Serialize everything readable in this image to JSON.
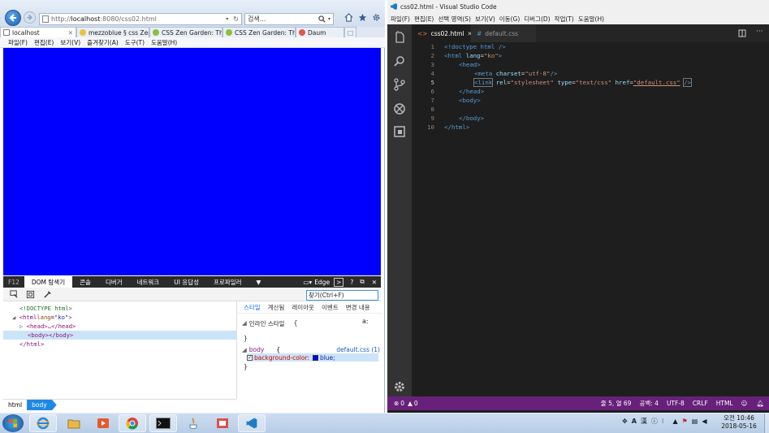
{
  "ie": {
    "address_host": "localhost",
    "address_pre": "http://",
    "address_post": ":8080/css02.html",
    "search_placeholder": "검색...",
    "tabs": [
      {
        "label": "localhost"
      },
      {
        "label": "mezzoblue § css Zen..."
      },
      {
        "label": "CSS Zen Garden: The..."
      },
      {
        "label": "CSS Zen Garden: The..."
      },
      {
        "label": "Daum"
      }
    ],
    "menu": [
      "파일(F)",
      "편집(E)",
      "보기(V)",
      "즐겨찾기(A)",
      "도구(T)",
      "도움말(H)"
    ],
    "page_background": "#0000ff"
  },
  "devtools": {
    "f12_label": "F12",
    "tabs": [
      "DOM 탐색기",
      "콘솔",
      "디버거",
      "네트워크",
      "UI 응답성",
      "프로파일러"
    ],
    "mode_label": "Edge",
    "find_placeholder": "찾기(Ctrl+F)",
    "dom": {
      "doctype": "<!DOCTYPE html>",
      "html_open": "<html",
      "lang_attr": "lang",
      "lang_val": "\"ko\"",
      "head": "<head>…</head>",
      "body": "<body></body>",
      "html_close": "</html>"
    },
    "style_tabs": [
      "스타일",
      "계산됨",
      "레이아웃",
      "이벤트",
      "변경 내용"
    ],
    "inline_label": "인라인 스타일",
    "inline_brace_open": "{",
    "inline_brace_close": "}",
    "aa_label": "a:",
    "rule_selector": "body",
    "rule_brace_open": "{",
    "rule_source": "default.css (1)",
    "rule_prop": "background-color:",
    "rule_value": "blue;",
    "rule_brace_close": "}",
    "breadcrumb": [
      "html",
      "body"
    ]
  },
  "vscode": {
    "title": "css02.html - Visual Studio Code",
    "menu": [
      "파일(F)",
      "편집(E)",
      "선택 영역(S)",
      "보기(V)",
      "이동(G)",
      "디버그(D)",
      "작업(T)",
      "도움말(H)"
    ],
    "tabs": [
      {
        "label": "css02.html",
        "icon": "<>"
      },
      {
        "label": "default.css",
        "icon": "#"
      }
    ],
    "line_numbers": [
      "1",
      "2",
      "3",
      "4",
      "5",
      "6",
      "7",
      "8",
      "9",
      "10"
    ],
    "code": {
      "l1": "<!doctype html />",
      "l2_tag": "<html",
      "l2_attr": "lang",
      "l2_val": "\"ko\"",
      "l2_end": ">",
      "l3": "<head>",
      "l4_tag": "<meta",
      "l4_attr": "charset",
      "l4_val": "\"utf-8\"",
      "l4_end": "/>",
      "l5_tag": "<link",
      "l5_a1": "rel",
      "l5_v1": "\"stylesheet\"",
      "l5_a2": "type",
      "l5_v2": "\"text/css\"",
      "l5_a3": "href",
      "l5_v3": "\"default.css\"",
      "l5_end": "/>",
      "l6": "</head>",
      "l7": "<body>",
      "l9": "</body>",
      "l10": "</html>"
    },
    "status": {
      "errors": "0",
      "warnings": "0",
      "position": "줄 5, 열 69",
      "spaces": "공백: 4",
      "encoding": "UTF-8",
      "eol": "CRLF",
      "language": "HTML"
    }
  },
  "taskbar": {
    "ime_lang": "A",
    "ime_mode": "漢",
    "clock_ampm_time": "오전 10:46",
    "clock_date": "2018-05-16"
  }
}
